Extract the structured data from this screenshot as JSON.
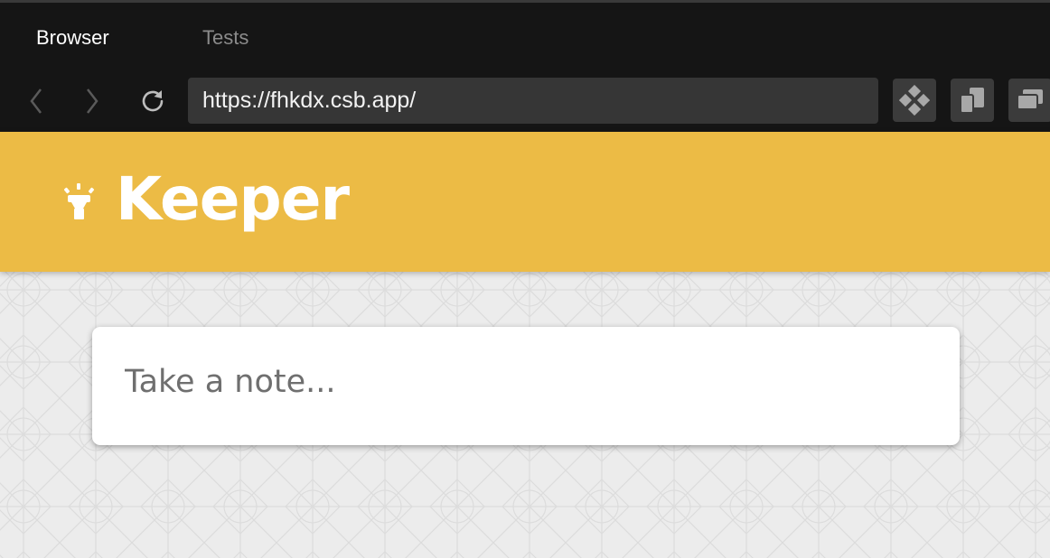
{
  "browser": {
    "tabs": [
      {
        "label": "Browser",
        "active": true
      },
      {
        "label": "Tests",
        "active": false
      }
    ],
    "url": "https://fhkdx.csb.app/",
    "nav_icons": [
      "chevron-left-icon",
      "chevron-right-icon",
      "reload-icon"
    ],
    "tool_icons": [
      "diamond-grid-icon",
      "copy-icon",
      "windows-icon"
    ]
  },
  "app": {
    "title": "Keeper",
    "logo_icon": "flashlight-icon",
    "header_color": "#ecbb45"
  },
  "note_input": {
    "placeholder": "Take a note...",
    "value": ""
  }
}
